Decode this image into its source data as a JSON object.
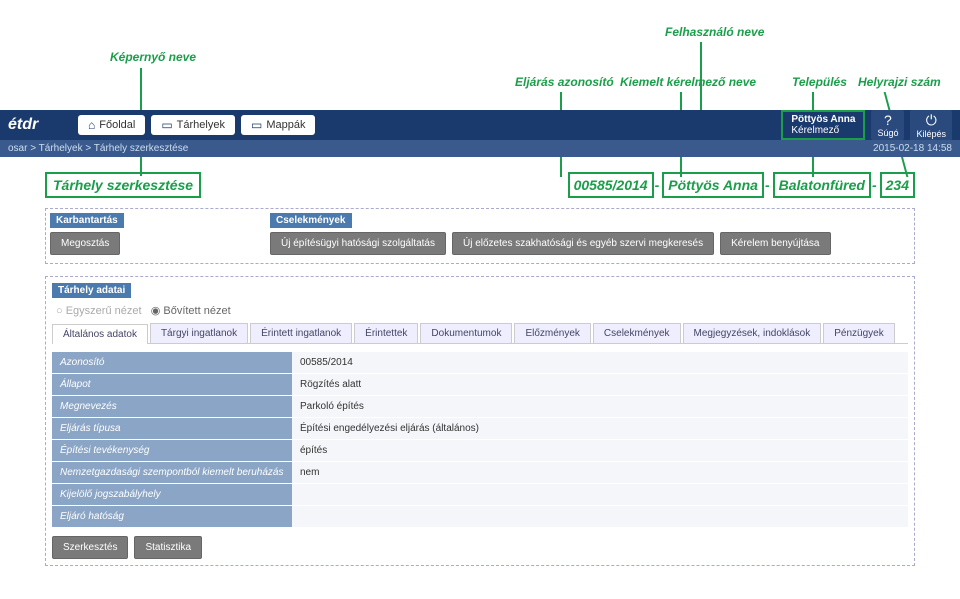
{
  "annotations": {
    "screen_name_label": "Képernyő neve",
    "user_name_label": "Felhasználó neve",
    "case_id_label": "Eljárás azonosító",
    "applicant_label": "Kiemelt kérelmező neve",
    "city_label": "Település",
    "parcel_label": "Helyrajzi szám"
  },
  "header": {
    "logo_main": "étdr",
    "logo_sub": "",
    "nav": {
      "home": "Főoldal",
      "storages": "Tárhelyek",
      "folders": "Mappák"
    },
    "user": {
      "name": "Pöttyös Anna",
      "role": "Kérelmező"
    },
    "help": "Súgó",
    "logout": "Kilépés"
  },
  "breadcrumb": "osar > Tárhelyek > Tárhely szerkesztése",
  "timestamp": "2015-02-18 14:58",
  "title": {
    "screen": "Tárhely szerkesztése",
    "case_id": "00585/2014",
    "applicant": "Pöttyös Anna",
    "city": "Balatonfüred",
    "parcel": "234"
  },
  "panels": {
    "left_title": "Karbantartás",
    "right_title": "Cselekmények",
    "share": "Megosztás",
    "action1": "Új építésügyi hatósági szolgáltatás",
    "action2": "Új előzetes szakhatósági és egyéb szervi megkeresés",
    "action3": "Kérelem benyújtása"
  },
  "main": {
    "title": "Tárhely adatai",
    "view_simple": "Egyszerű nézet",
    "view_expanded": "Bővített nézet",
    "tabs": {
      "t0": "Általános adatok",
      "t1": "Tárgyi ingatlanok",
      "t2": "Érintett ingatlanok",
      "t3": "Érintettek",
      "t4": "Dokumentumok",
      "t5": "Előzmények",
      "t6": "Cselekmények",
      "t7": "Megjegyzések, indoklások",
      "t8": "Pénzügyek"
    },
    "rows": {
      "r0": {
        "k": "Azonosító",
        "v": "00585/2014"
      },
      "r1": {
        "k": "Állapot",
        "v": "Rögzítés alatt"
      },
      "r2": {
        "k": "Megnevezés",
        "v": "Parkoló építés"
      },
      "r3": {
        "k": "Eljárás típusa",
        "v": "Építési engedélyezési eljárás (általános)"
      },
      "r4": {
        "k": "Építési tevékenység",
        "v": "építés"
      },
      "r5": {
        "k": "Nemzetgazdasági szempontból kiemelt beruházás",
        "v": "nem"
      },
      "r6": {
        "k": "Kijelölő jogszabályhely",
        "v": ""
      },
      "r7": {
        "k": "Eljáró hatóság",
        "v": ""
      }
    },
    "edit_btn": "Szerkesztés",
    "stats_btn": "Statisztika"
  }
}
